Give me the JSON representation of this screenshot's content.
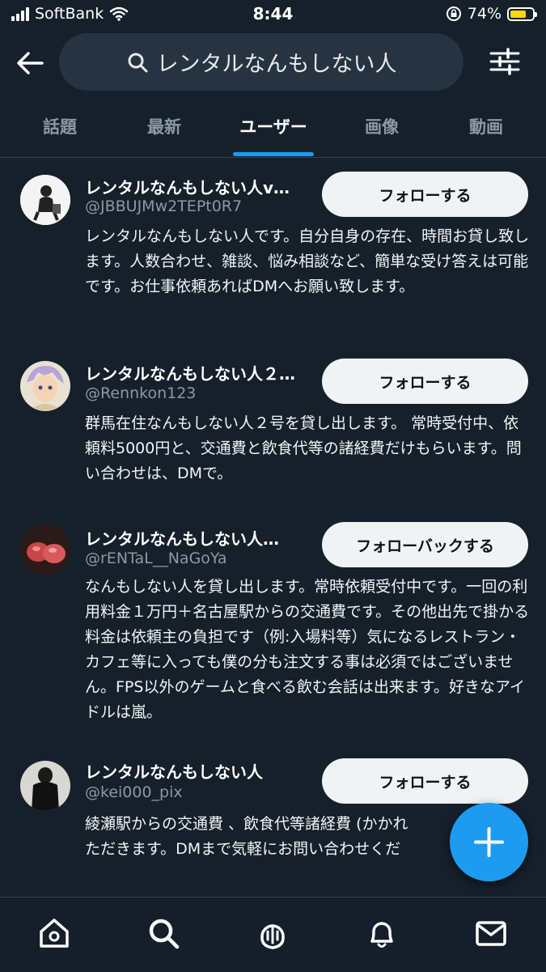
{
  "status": {
    "carrier": "SoftBank",
    "time": "8:44",
    "battery": "74%",
    "battery_level": 0.74
  },
  "search": {
    "query": "レンタルなんもしない人"
  },
  "tabs": [
    {
      "label": "話題"
    },
    {
      "label": "最新"
    },
    {
      "label": "ユーザー",
      "active": true
    },
    {
      "label": "画像"
    },
    {
      "label": "動画"
    }
  ],
  "users": [
    {
      "name": "レンタルなんもしない人v…",
      "handle": "@JBBUJMw2TEPt0R7",
      "button": "フォローする",
      "bio": "レンタルなんもしない人です。自分自身の存在、時間お貸し致します。人数合わせ、雑談、悩み相談など、簡単な受け答えは可能です。お仕事依頼あればDMへお願い致します。"
    },
    {
      "name": "レンタルなんもしない人２…",
      "handle": "@Rennkon123",
      "button": "フォローする",
      "bio": "群馬在住なんもしない人２号を貸し出します。 常時受付中、依頼料5000円と、交通費と飲食代等の諸経費だけもらいます。問い合わせは、DMで。"
    },
    {
      "name": "レンタルなんもしない人…",
      "handle": "@rENTaL__NaGoYa",
      "button": "フォローバックする",
      "bio": "なんもしない人を貸し出します。常時依頼受付中です。一回の利用料金１万円＋名古屋駅からの交通費です。その他出先で掛かる料金は依頼主の負担です（例:入場料等）気になるレストラン・カフェ等に入っても僕の分も注文する事は必須ではございません。FPS以外のゲームと食べる飲む会話は出来ます。好きなアイドルは嵐。"
    },
    {
      "name": "レンタルなんもしない人",
      "handle": "@kei000_pix",
      "button": "フォローする",
      "bio": "綾瀬駅からの交通費 、飲食代等諸経費 (かかれ\nただきます。DMまで気軽にお問い合わせくだ"
    }
  ],
  "colors": {
    "background": "#15202b",
    "accent": "#1d9bf0",
    "muted": "#8b98a5"
  },
  "icons": [
    "back-arrow-icon",
    "search-icon",
    "filter-sliders-icon",
    "compose-plus-icon",
    "home-icon",
    "search-icon",
    "spaces-icon",
    "notifications-bell-icon",
    "messages-envelope-icon"
  ]
}
